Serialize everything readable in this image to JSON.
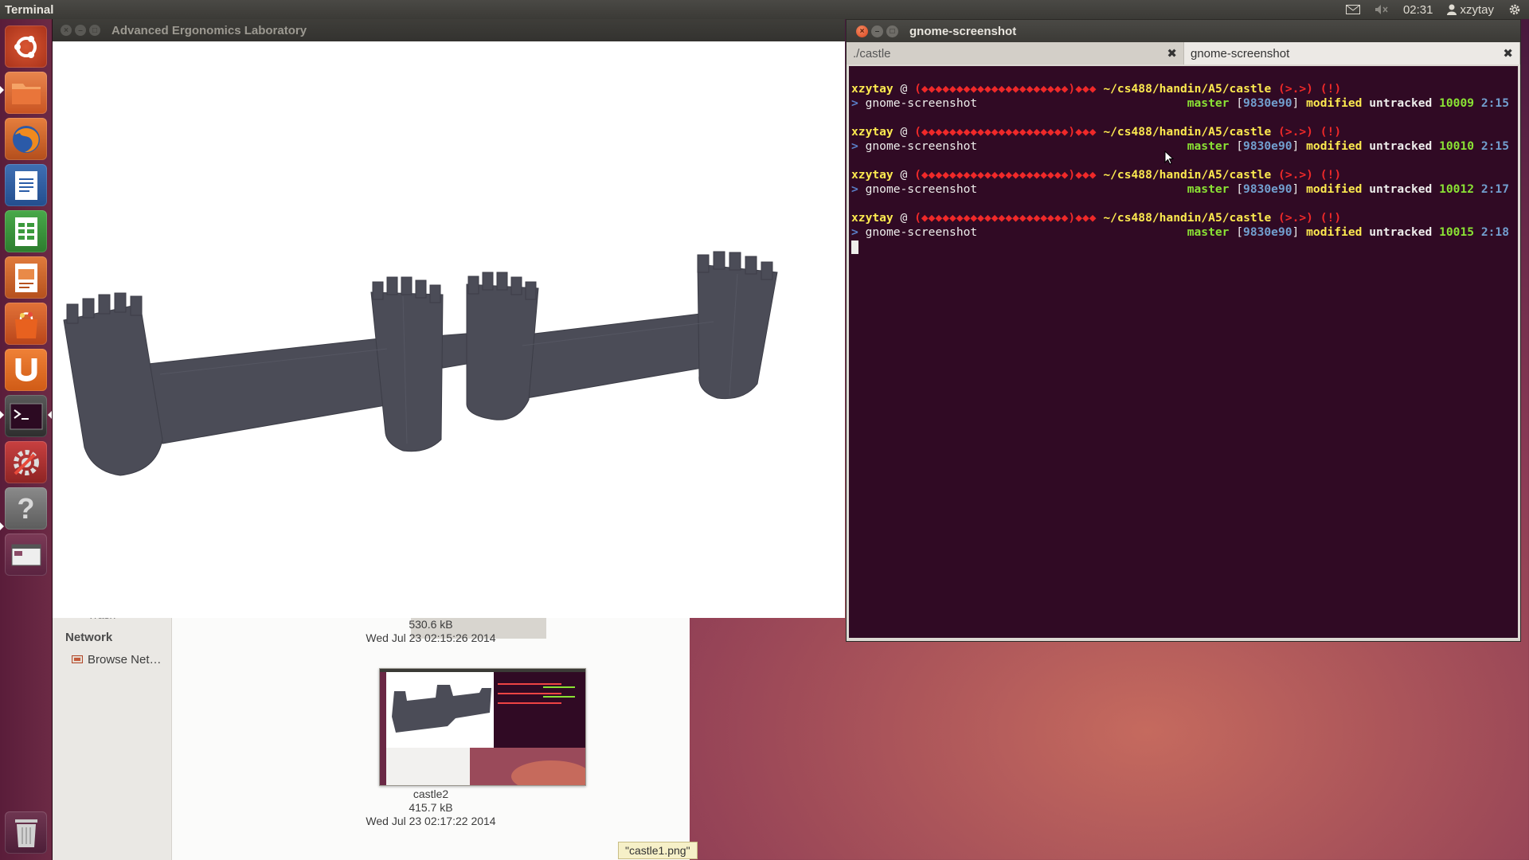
{
  "top_panel": {
    "app_title": "Terminal",
    "clock": "02:31",
    "user": "xzytay"
  },
  "launcher": {
    "items": [
      "dash",
      "files",
      "firefox",
      "writer",
      "calc",
      "impress",
      "software-center",
      "ubuntu-one",
      "terminal",
      "system-settings",
      "help",
      "workspace-switcher",
      "trash"
    ]
  },
  "castle_window": {
    "title": "Advanced Ergonomics Laboratory",
    "castle_color": "#4b4c57"
  },
  "file_manager": {
    "sidebar_partial": "Trash",
    "network_heading": "Network",
    "browse_network": "Browse Net…",
    "prev_file_size": "530.6 kB",
    "prev_file_date": "Wed Jul 23 02:15:26 2014",
    "thumb_name": "castle2",
    "thumb_size": "415.7 kB",
    "thumb_date": "Wed Jul 23 02:17:22 2014",
    "status": "\"castle1.png\" selected (530.6 kB)"
  },
  "terminal": {
    "title": "gnome-screenshot",
    "tabs": [
      {
        "label": "./castle",
        "active": false
      },
      {
        "label": "gnome-screenshot",
        "active": true
      }
    ],
    "prompts": [
      {
        "user": "xzytay",
        "host": "(◆◆◆◆◆◆◆◆◆◆◆◆◆◆◆◆◆◆◆◆◆)◆◆◆",
        "path": "~/cs488/handin/A5/castle",
        "face": "(>.>)",
        "bang": "(!)",
        "command": "gnome-screenshot",
        "branch": "master",
        "hash": "9830e90",
        "modified": "modified",
        "untracked": "untracked",
        "histnum": "10009",
        "time": "2:15"
      },
      {
        "user": "xzytay",
        "host": "(◆◆◆◆◆◆◆◆◆◆◆◆◆◆◆◆◆◆◆◆◆)◆◆◆",
        "path": "~/cs488/handin/A5/castle",
        "face": "(>.>)",
        "bang": "(!)",
        "command": "gnome-screenshot",
        "branch": "master",
        "hash": "9830e90",
        "modified": "modified",
        "untracked": "untracked",
        "histnum": "10010",
        "time": "2:15"
      },
      {
        "user": "xzytay",
        "host": "(◆◆◆◆◆◆◆◆◆◆◆◆◆◆◆◆◆◆◆◆◆)◆◆◆",
        "path": "~/cs488/handin/A5/castle",
        "face": "(>.>)",
        "bang": "(!)",
        "command": "gnome-screenshot",
        "branch": "master",
        "hash": "9830e90",
        "modified": "modified",
        "untracked": "untracked",
        "histnum": "10012",
        "time": "2:17"
      },
      {
        "user": "xzytay",
        "host": "(◆◆◆◆◆◆◆◆◆◆◆◆◆◆◆◆◆◆◆◆◆)◆◆◆",
        "path": "~/cs488/handin/A5/castle",
        "face": "(>.>)",
        "bang": "(!)",
        "command": "gnome-screenshot",
        "branch": "master",
        "hash": "9830e90",
        "modified": "modified",
        "untracked": "untracked",
        "histnum": "10015",
        "time": "2:18"
      }
    ],
    "at_sign": "@",
    "prompt_arrow": ">"
  }
}
